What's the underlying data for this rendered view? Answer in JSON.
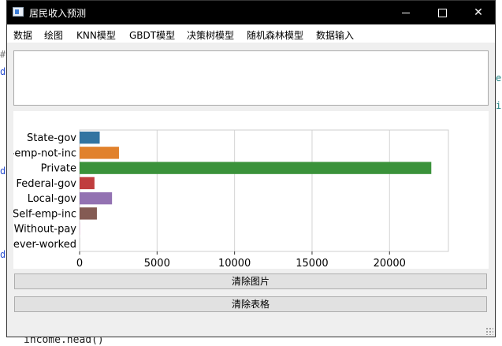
{
  "window": {
    "title": "居民收入预测"
  },
  "menu": [
    "数据",
    "绘图",
    "KNN模型",
    "GBDT模型",
    "决策树模型",
    "随机森林模型",
    "数据输入"
  ],
  "buttons": {
    "clear_image": "清除图片",
    "clear_table": "清除表格"
  },
  "background": {
    "bottom_code": "income.head()"
  },
  "chart_data": {
    "type": "bar",
    "orientation": "horizontal",
    "categories": [
      "State-gov",
      "Self-emp-not-inc",
      "Private",
      "Federal-gov",
      "Local-gov",
      "Self-emp-inc",
      "Without-pay",
      "Never-worked"
    ],
    "values": [
      1298,
      2541,
      22696,
      960,
      2093,
      1116,
      14,
      7
    ],
    "colors": [
      "#3274a1",
      "#e1812c",
      "#3a923a",
      "#c03d3e",
      "#9372b2",
      "#845b53",
      "#d684bd",
      "#7f7f7f"
    ],
    "xticks": [
      0,
      5000,
      10000,
      15000,
      20000
    ],
    "xlim": [
      0,
      23800
    ],
    "grid": true
  }
}
